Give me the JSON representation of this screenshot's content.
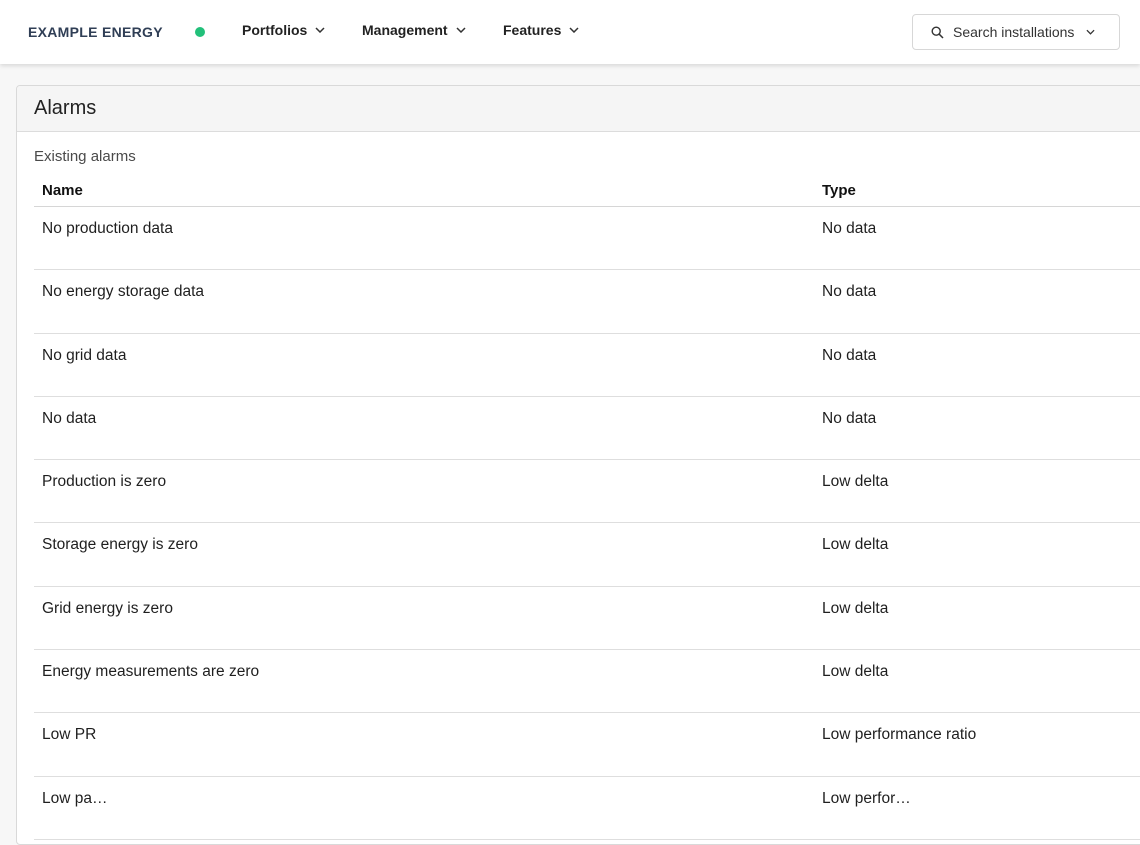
{
  "header": {
    "brand": "EXAMPLE ENERGY",
    "status_color": "#22c07a",
    "nav": [
      {
        "label": "Portfolios",
        "icon": "chevron-down-icon"
      },
      {
        "label": "Management",
        "icon": "chevron-down-icon"
      },
      {
        "label": "Features",
        "icon": "chevron-down-icon"
      }
    ],
    "search": {
      "placeholder": "Search installations",
      "icon": "search-icon"
    }
  },
  "card": {
    "title": "Alarms",
    "section_label": "Existing alarms",
    "columns": {
      "name": "Name",
      "type": "Type"
    },
    "rows": [
      {
        "name": "No production data",
        "type": "No data"
      },
      {
        "name": "No energy storage data",
        "type": "No data"
      },
      {
        "name": "No grid data",
        "type": "No data"
      },
      {
        "name": "No data",
        "type": "No data"
      },
      {
        "name": "Production is zero",
        "type": "Low delta"
      },
      {
        "name": "Storage energy is zero",
        "type": "Low delta"
      },
      {
        "name": "Grid energy is zero",
        "type": "Low delta"
      },
      {
        "name": "Energy measurements are zero",
        "type": "Low delta"
      },
      {
        "name": "Low PR",
        "type": "Low performance ratio"
      },
      {
        "name": "Low pa…",
        "type": "Low perfor…"
      }
    ]
  }
}
